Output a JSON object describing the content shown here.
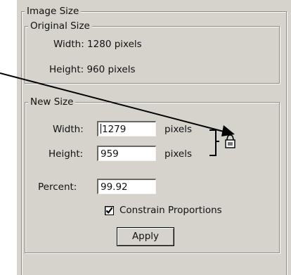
{
  "image_size": {
    "title": "Image Size",
    "original_size": {
      "title": "Original Size",
      "width_text": "Width: 1280 pixels",
      "height_text": "Height: 960 pixels"
    },
    "new_size": {
      "title": "New Size",
      "width_label": "Width:",
      "width_value": "1279",
      "width_unit": "pixels",
      "height_label": "Height:",
      "height_value": "959",
      "height_unit": "pixels",
      "percent_label": "Percent:",
      "percent_value": "99.92",
      "constrain_label": "Constrain Proportions",
      "constrain_checked": true,
      "apply_label": "Apply"
    }
  },
  "icons": {
    "checkbox_check": "check-mark",
    "lock": "lock-icon",
    "pointer": "arrow-pointer"
  },
  "colors": {
    "panel_bg": "#d6d3cd",
    "page_bg": "#ffffff"
  }
}
